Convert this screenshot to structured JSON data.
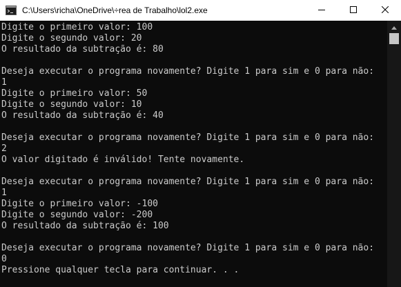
{
  "window": {
    "title": "C:\\Users\\richa\\OneDrive\\÷rea de Trabalho\\lol2.exe",
    "icons": {
      "app": "console-app-icon",
      "minimize": "minimize-icon",
      "maximize": "maximize-icon",
      "close": "close-icon"
    }
  },
  "console": {
    "lines": [
      "Digite o primeiro valor: 100",
      "Digite o segundo valor: 20",
      "O resultado da subtração é: 80",
      "",
      "Deseja executar o programa novamente? Digite 1 para sim e 0 para não:",
      "1",
      "Digite o primeiro valor: 50",
      "Digite o segundo valor: 10",
      "O resultado da subtração é: 40",
      "",
      "Deseja executar o programa novamente? Digite 1 para sim e 0 para não:",
      "2",
      "O valor digitado é inválido! Tente novamente.",
      "",
      "Deseja executar o programa novamente? Digite 1 para sim e 0 para não:",
      "1",
      "Digite o primeiro valor: -100",
      "Digite o segundo valor: -200",
      "O resultado da subtração é: 100",
      "",
      "Deseja executar o programa novamente? Digite 1 para sim e 0 para não:",
      "0",
      "Pressione qualquer tecla para continuar. . ."
    ]
  },
  "colors": {
    "background": "#0c0c0c",
    "text": "#cccccc",
    "titlebar": "#ffffff"
  }
}
